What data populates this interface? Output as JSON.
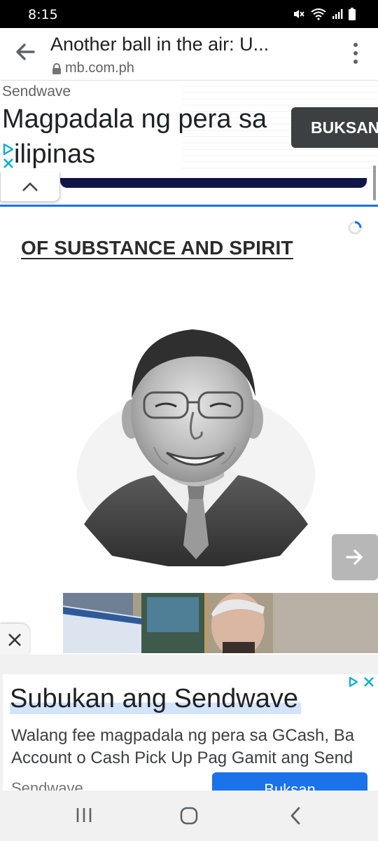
{
  "status_bar": {
    "time": "8:15"
  },
  "browser": {
    "page_title": "Another ball in the air: U...",
    "url": "mb.com.ph"
  },
  "top_ad": {
    "advertiser": "Sendwave",
    "headline_line1": "Magpadala ng pera sa",
    "headline_line2": "ilipinas",
    "cta": "BUKSAN"
  },
  "article": {
    "section_title": "OF SUBSTANCE AND SPIRIT"
  },
  "bottom_ad": {
    "headline": "Subukan ang Sendwave",
    "body_line1": "Walang fee magpadala ng pera sa GCash, Ba",
    "body_line2": "Account o Cash Pick Up Pag Gamit ang Send",
    "advertiser": "Sendwave",
    "cta": "Buksan"
  },
  "colors": {
    "accent_blue": "#1a73e8",
    "ad_cta_dark": "#3c4043",
    "navy_banner": "#0f1547"
  }
}
